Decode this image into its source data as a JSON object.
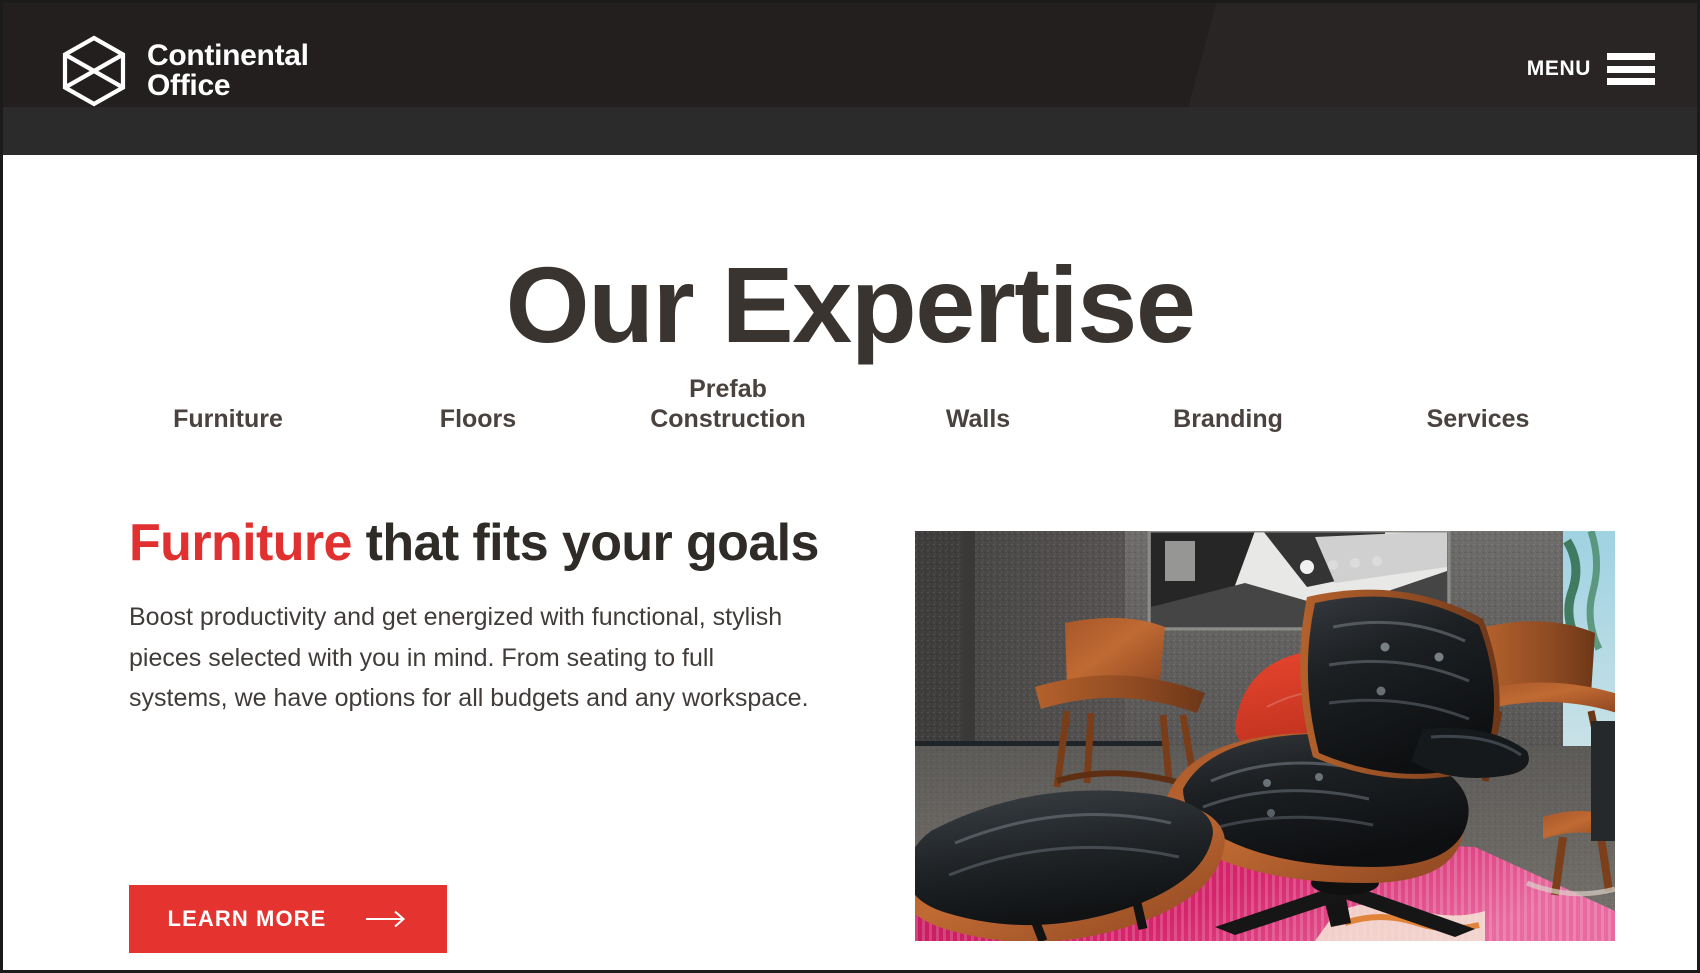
{
  "header": {
    "brand": {
      "logo_icon": "hexagon-bowtie-logo-icon",
      "line1": "Continental",
      "line2": "Office"
    },
    "menu": {
      "label": "MENU",
      "icon": "hamburger-menu-icon"
    },
    "colors": {
      "bar_upper": "#231f1f",
      "bar_lower": "#2b2b2b",
      "text": "#ffffff"
    }
  },
  "page": {
    "title": "Our Expertise",
    "title_color": "#3a3430",
    "background": "#ffffff"
  },
  "tabs": [
    {
      "label": "Furniture",
      "lines": [
        "Furniture"
      ],
      "active": true
    },
    {
      "label": "Floors",
      "lines": [
        "Floors"
      ],
      "active": false
    },
    {
      "label": "Prefab Construction",
      "lines": [
        "Prefab",
        "Construction"
      ],
      "active": false
    },
    {
      "label": "Walls",
      "lines": [
        "Walls"
      ],
      "active": false
    },
    {
      "label": "Branding",
      "lines": [
        "Branding"
      ],
      "active": false
    },
    {
      "label": "Services",
      "lines": [
        "Services"
      ],
      "active": false
    }
  ],
  "feature": {
    "headline_accent": "Furniture",
    "headline_rest": " that fits your goals",
    "accent_color": "#e0302f",
    "body": "Boost productivity and get energized with functional, stylish pieces selected with you in mind. From seating to full systems, we have options for all budgets and any workspace.",
    "cta": {
      "label": "LEARN MORE",
      "icon": "arrow-right-icon",
      "background": "#e5332f",
      "text_color": "#ffffff"
    },
    "image": {
      "alt": "Black leather Eames-style lounge chair and ottoman in a showroom with wood chairs, a red round chair, framed black-and-white artwork and a pink striped rug",
      "icon": "lounge-chair-photo"
    }
  }
}
